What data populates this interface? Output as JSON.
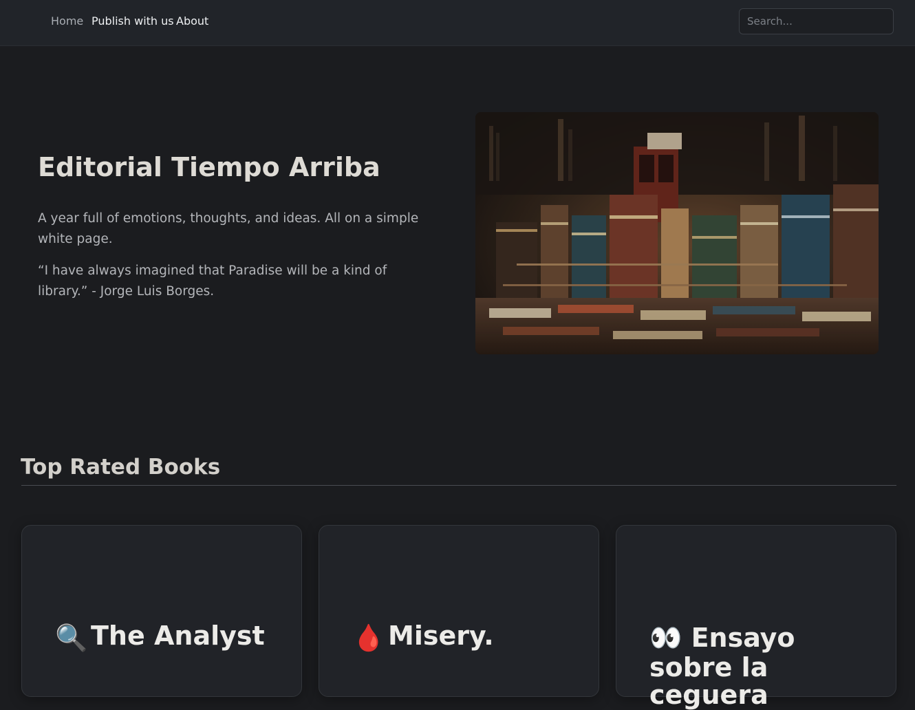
{
  "nav": {
    "links": [
      {
        "label": "Home"
      },
      {
        "label": "Publish with us"
      },
      {
        "label": "About"
      }
    ],
    "search_placeholder": "Search..."
  },
  "hero": {
    "title": "Editorial Tiempo Arriba",
    "paragraphs": [
      "A year full of emotions, thoughts, and ideas. All on a simple white page.",
      "“I have always imagined that Paradise will be a kind of library.” - Jorge Luis Borges."
    ],
    "image_icon": "bookstore-photo"
  },
  "top_rated": {
    "heading": "Top Rated Books",
    "books": [
      {
        "emoji": "🔍",
        "icon": "magnifying-glass-icon",
        "title": "The Analyst"
      },
      {
        "emoji": "🩸",
        "icon": "blood-drop-icon",
        "title": "Misery."
      },
      {
        "emoji": "👀",
        "icon": "eyes-icon",
        "title": "Ensayo sobre la ceguera"
      }
    ]
  }
}
